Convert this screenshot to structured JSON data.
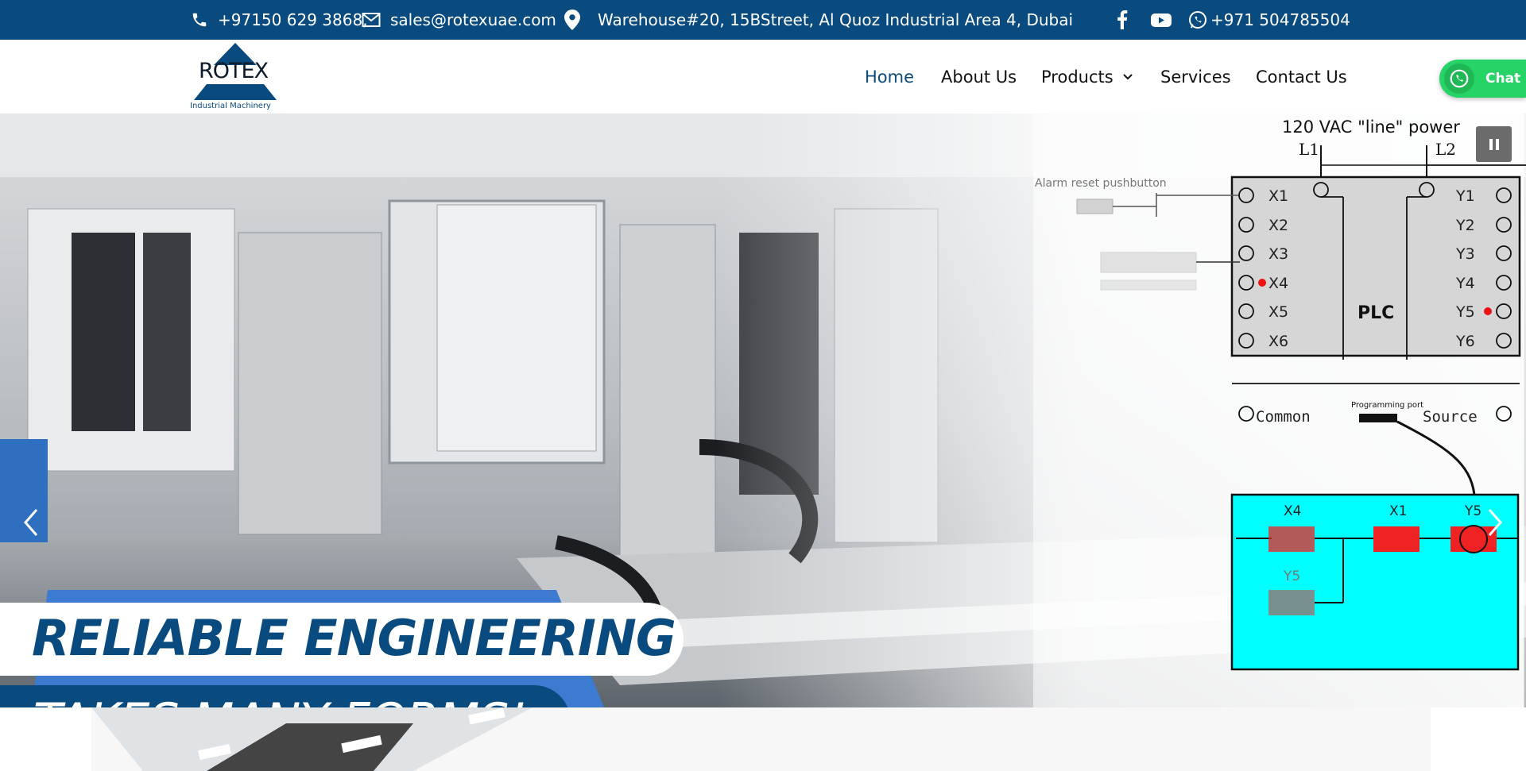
{
  "topbar": {
    "phone": "+97150 629 3868,",
    "email": "sales@rotexuae.com",
    "address": "Warehouse#20, 15BStreet, Al Quoz Industrial Area 4, Dubai",
    "whatsapp": "+971 504785504"
  },
  "logo": {
    "name": "ROTEX",
    "tagline": "Industrial Machinery"
  },
  "nav": {
    "items": [
      {
        "label": "Home",
        "active": true
      },
      {
        "label": "About Us"
      },
      {
        "label": "Products",
        "has_dropdown": true
      },
      {
        "label": "Services"
      },
      {
        "label": "Contact Us"
      }
    ]
  },
  "chat": {
    "label": "Chat"
  },
  "hero": {
    "line1": "RELIABLE ENGINEERING",
    "line2": "TAKES MANY FORMS!",
    "diagram": {
      "title": "120 VAC \"line\" power",
      "l1": "L1",
      "l2": "L2",
      "inputs": [
        "X1",
        "X2",
        "X3",
        "X4",
        "X5",
        "X6"
      ],
      "outputs": [
        "Y1",
        "Y2",
        "Y3",
        "Y4",
        "Y5",
        "Y6"
      ],
      "plc": "PLC",
      "common": "Common",
      "source": "Source",
      "prog_port": "Programming port",
      "alarm": "Alarm reset pushbutton",
      "ladder": [
        "X4",
        "X1",
        "Y5",
        "Y5"
      ]
    }
  },
  "colors": {
    "brand": "#0a4b7f",
    "whatsapp": "#25d366",
    "ladder_bg": "#00ffff"
  }
}
